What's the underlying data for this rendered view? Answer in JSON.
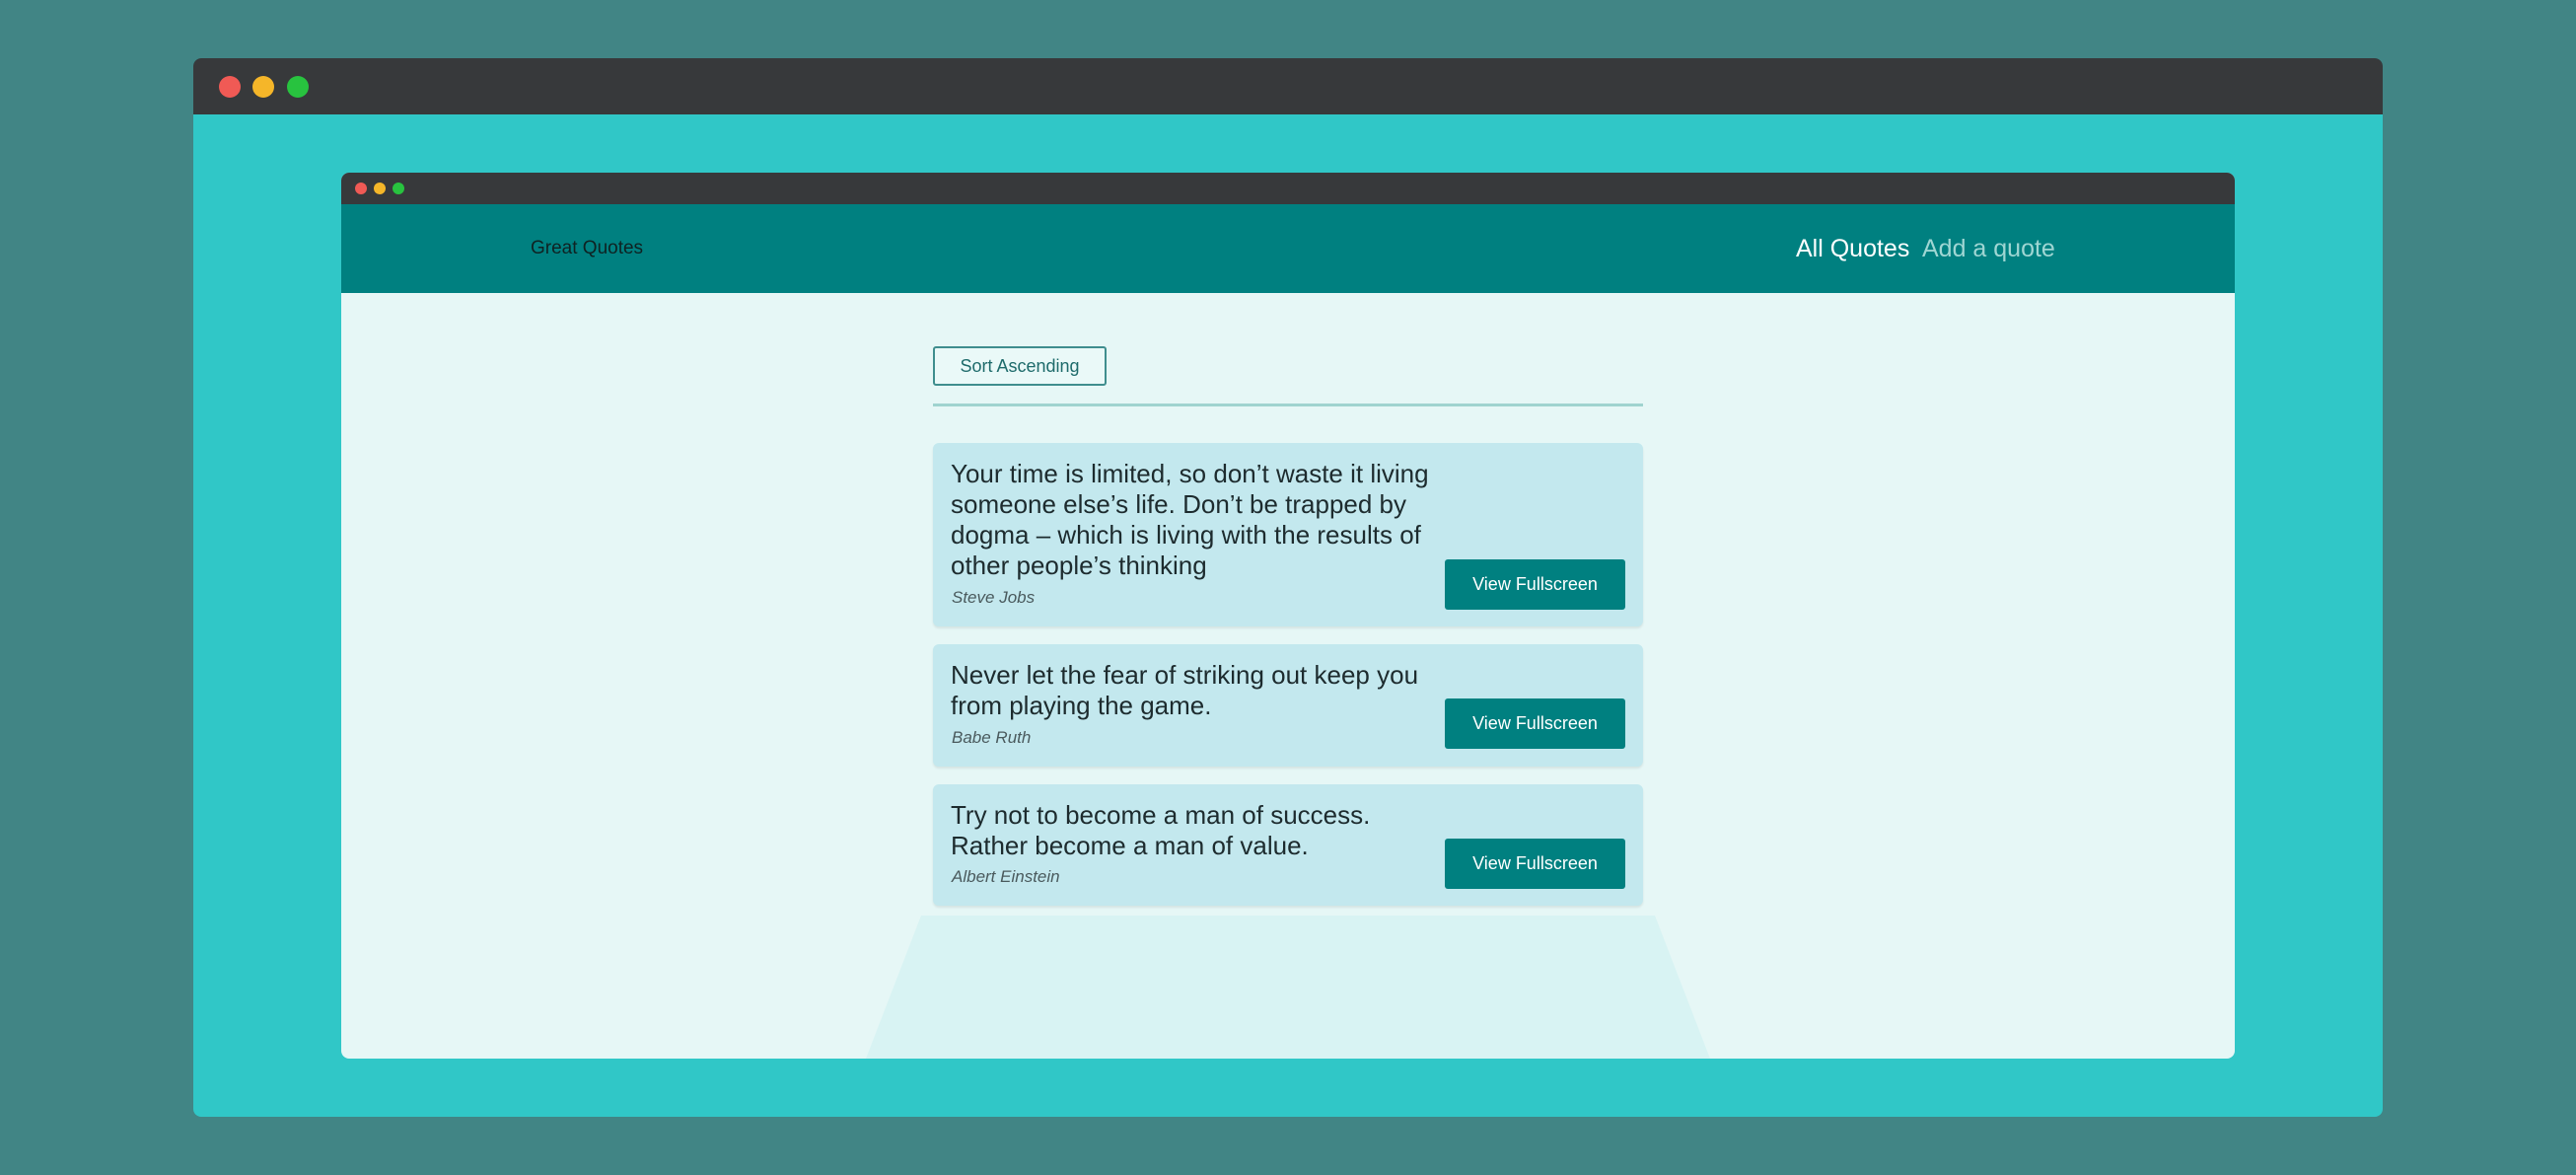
{
  "app": {
    "brand": "Great Quotes"
  },
  "nav": {
    "all_quotes": "All Quotes",
    "add_quote": "Add a quote"
  },
  "toolbar": {
    "sort_label": "Sort Ascending"
  },
  "quotes": [
    {
      "text": "Your time is limited, so don’t waste it living someone else’s life. Don’t be trapped by dogma – which is living with the results of other people’s thinking",
      "author": "Steve Jobs",
      "button": "View Fullscreen"
    },
    {
      "text": "Never let the fear of striking out keep you from playing the game.",
      "author": "Babe Ruth",
      "button": "View Fullscreen"
    },
    {
      "text": "Try not to become a man of success. Rather become a man of value.",
      "author": "Albert Einstein",
      "button": "View Fullscreen"
    }
  ],
  "colors": {
    "background": "#418585",
    "frame": "#30c7c7",
    "titlebar": "#37393b",
    "navbar": "#008080",
    "page": "#e6f7f6",
    "card": "#c3e8ee",
    "accent": "#008080"
  }
}
